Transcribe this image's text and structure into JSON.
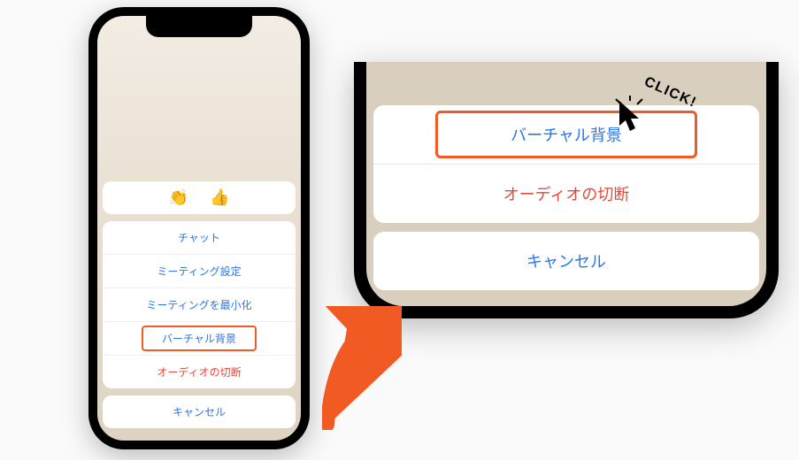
{
  "left_phone": {
    "emoji_clap": "👏",
    "emoji_thumb": "👍",
    "items": [
      {
        "label": "チャット"
      },
      {
        "label": "ミーティング設定"
      },
      {
        "label": "ミーティングを最小化"
      },
      {
        "label": "バーチャル背景",
        "highlight": true
      },
      {
        "label": "オーディオの切断",
        "danger": true
      }
    ],
    "cancel": "キャンセル"
  },
  "right_phone": {
    "items": [
      {
        "label": "バーチャル背景",
        "highlight": true
      },
      {
        "label": "オーディオの切断",
        "danger": true
      }
    ],
    "cancel": "キャンセル"
  },
  "callout": {
    "click_text": "CLICK!"
  },
  "colors": {
    "accent": "#f15a22",
    "link": "#2a77e8",
    "danger": "#e04a3a"
  }
}
